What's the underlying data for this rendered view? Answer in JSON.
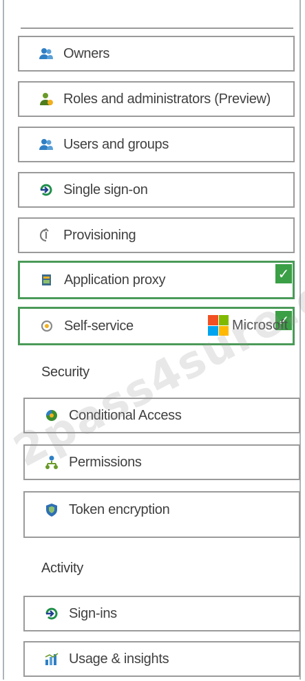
{
  "menu": {
    "items": [
      {
        "label": "Owners",
        "icon": "owners-icon"
      },
      {
        "label": "Roles and administrators (Preview)",
        "icon": "roles-icon"
      },
      {
        "label": "Users and groups",
        "icon": "users-groups-icon"
      },
      {
        "label": "Single sign-on",
        "icon": "single-sign-on-icon"
      },
      {
        "label": "Provisioning",
        "icon": "provisioning-icon"
      },
      {
        "label": "Application proxy",
        "icon": "application-proxy-icon",
        "selected": true
      },
      {
        "label": "Self-service",
        "icon": "self-service-icon",
        "selected": true
      },
      {
        "label": "Conditional Access",
        "icon": "conditional-access-icon"
      },
      {
        "label": "Permissions",
        "icon": "permissions-icon"
      },
      {
        "label": "Token encryption",
        "icon": "token-encryption-icon"
      },
      {
        "label": "Sign-ins",
        "icon": "sign-ins-icon"
      },
      {
        "label": "Usage & insights",
        "icon": "usage-insights-icon"
      }
    ],
    "sections": {
      "security": "Security",
      "activity": "Activity"
    }
  },
  "overlay": {
    "microsoft_text": "Microsoft",
    "watermark": "2pass4sure.com",
    "check_mark": "✓"
  },
  "colors": {
    "selected_border": "#4a9a58",
    "check": "#3a9f45",
    "border": "#9a9a9a"
  }
}
